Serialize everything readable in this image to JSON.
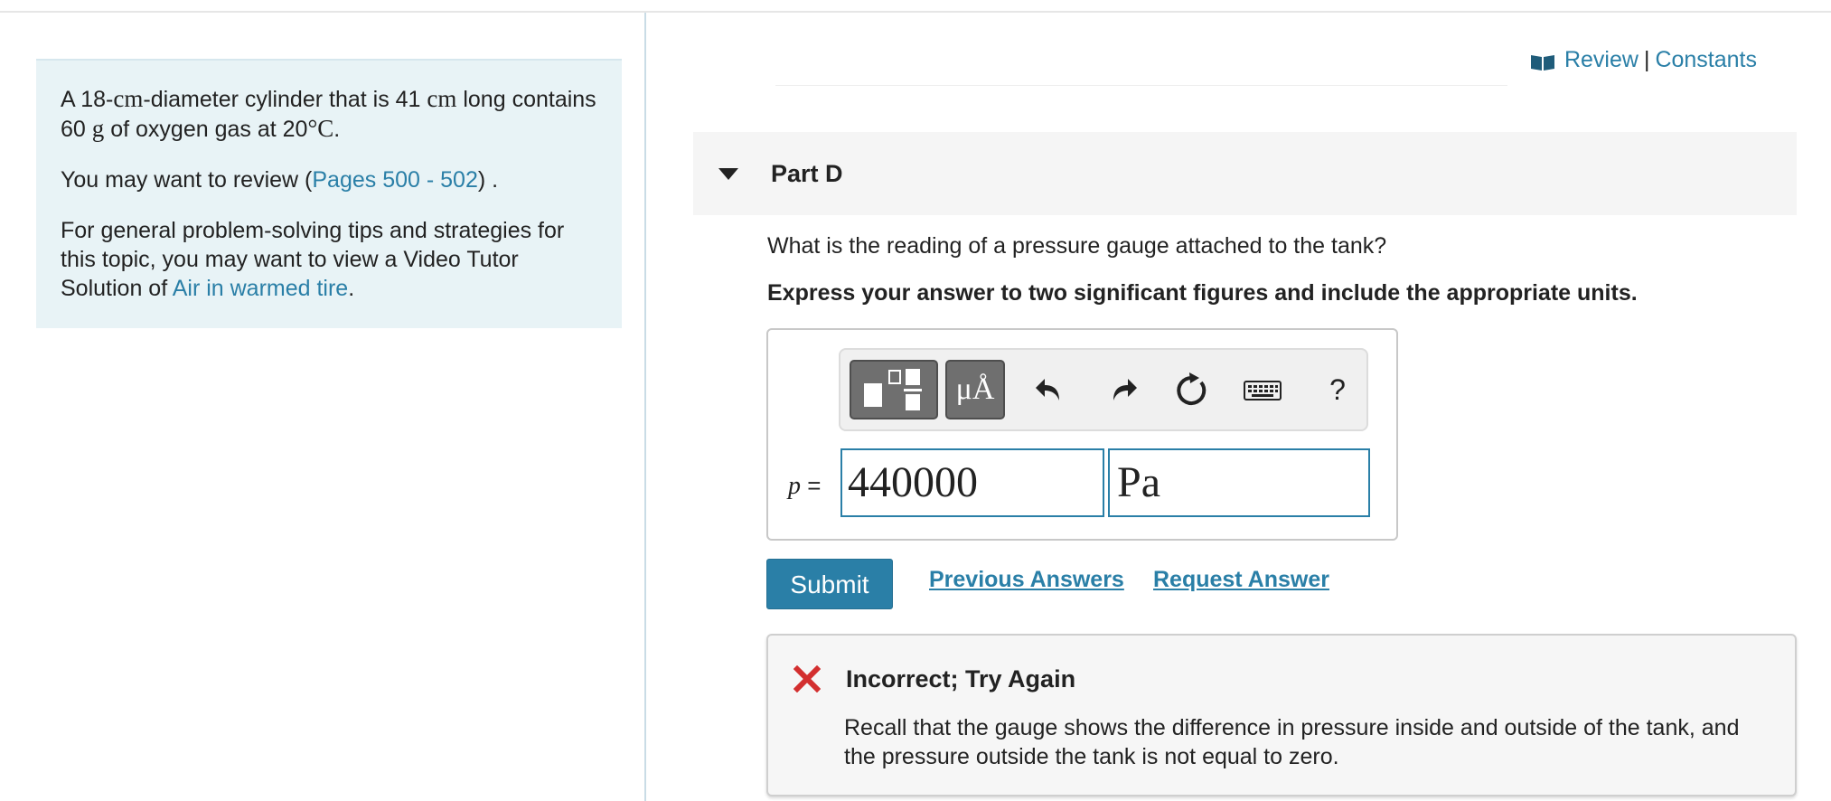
{
  "problem": {
    "statement_parts": [
      "A 18-",
      "cm",
      "-diameter cylinder that is 41 ",
      "cm",
      " long contains 60 ",
      "g",
      " of oxygen gas at 20",
      "°C",
      "."
    ],
    "review_prefix": "You may want to review (",
    "review_link": "Pages 500 - 502",
    "review_suffix": ") .",
    "tips_text": "For general problem-solving tips and strategies for this topic, you may want to view a Video Tutor Solution of ",
    "tips_link": "Air in warmed tire",
    "tips_suffix": "."
  },
  "header": {
    "review_label": "Review",
    "separator": "|",
    "constants_label": "Constants"
  },
  "part": {
    "title": "Part D",
    "question": "What is the reading of a pressure gauge attached to the tank?",
    "instruction": "Express your answer to two significant figures and include the appropriate units."
  },
  "toolbar": {
    "units_label": "μÅ",
    "help_label": "?",
    "icons": [
      "templates-icon",
      "units-icon",
      "undo-icon",
      "redo-icon",
      "reset-icon",
      "keyboard-icon",
      "help-icon"
    ]
  },
  "answer": {
    "variable": "p",
    "equals": "=",
    "value": "440000",
    "unit": "Pa"
  },
  "actions": {
    "submit_label": "Submit",
    "previous_answers_label": "Previous Answers",
    "request_answer_label": "Request Answer"
  },
  "feedback": {
    "title": "Incorrect; Try Again",
    "message": "Recall that the gauge shows the difference in pressure inside and outside of the tank, and the pressure outside the tank is not equal to zero."
  },
  "colors": {
    "accent": "#2a7fa7",
    "panel_bg": "#e8f3f6",
    "error": "#d32f2f",
    "toolbar_dark": "#6f6f6f"
  }
}
